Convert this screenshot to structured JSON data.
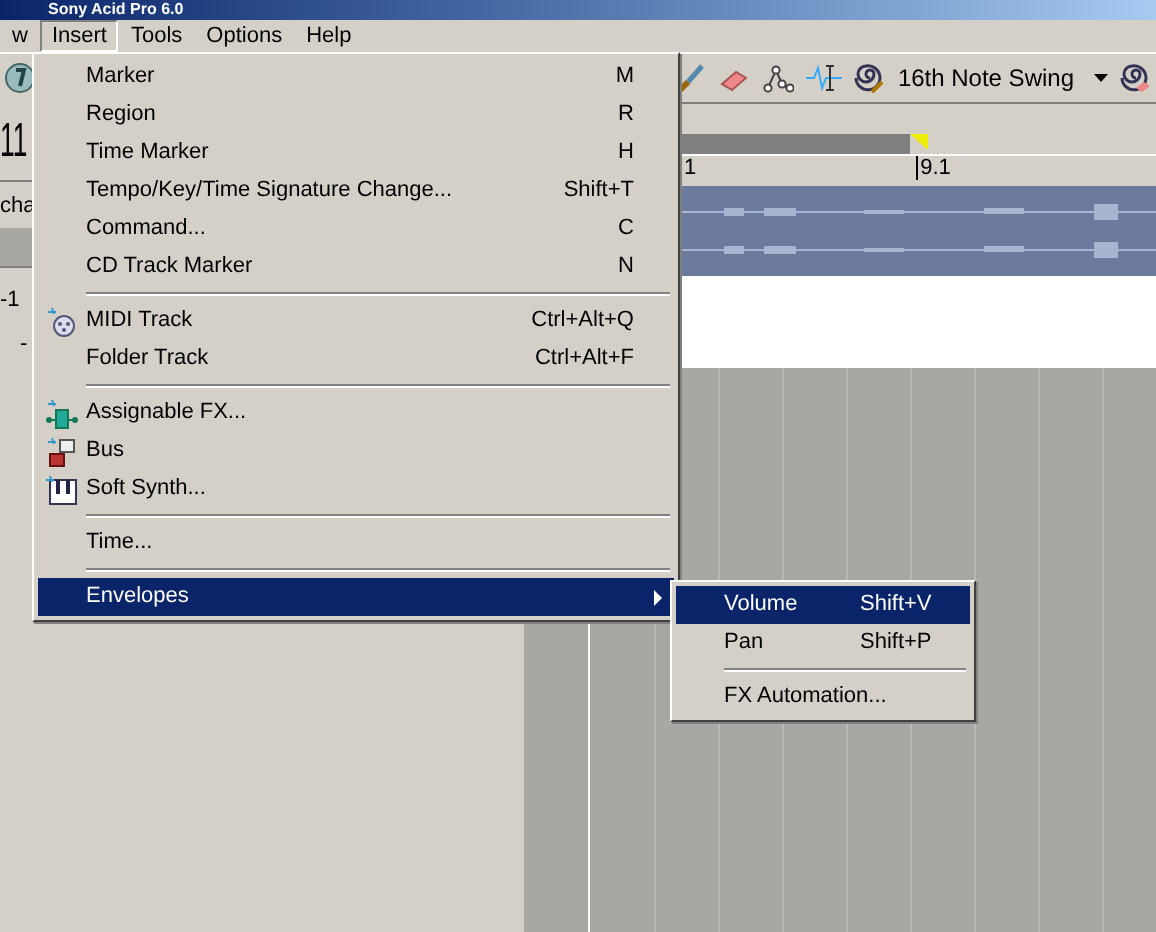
{
  "window": {
    "title": "Sony Acid Pro 6.0"
  },
  "menu_bar": [
    {
      "label": "w",
      "selected": false
    },
    {
      "label": "Insert",
      "selected": true
    },
    {
      "label": "Tools",
      "selected": false
    },
    {
      "label": "Options",
      "selected": false
    },
    {
      "label": "Help",
      "selected": false
    }
  ],
  "left_panel": {
    "counter": "11",
    "label": "cha",
    "value": "-1",
    "value_2": "-"
  },
  "toolbar": {
    "swing": "16th Note Swing"
  },
  "ruler": {
    "marks": [
      "1",
      "9.1"
    ]
  },
  "insert_menu": {
    "groups": [
      [
        {
          "kind": "plain",
          "label": "Marker",
          "shortcut": "M",
          "selected": false
        },
        {
          "kind": "plain",
          "label": "Region",
          "shortcut": "R",
          "selected": false
        },
        {
          "kind": "plain",
          "label": "Time Marker",
          "shortcut": "H",
          "selected": false
        },
        {
          "kind": "plain",
          "label": "Tempo/Key/Time Signature Change...",
          "shortcut": "Shift+T",
          "selected": false
        },
        {
          "kind": "plain",
          "label": "Command...",
          "shortcut": "C",
          "selected": false
        },
        {
          "kind": "plain",
          "label": "CD Track Marker",
          "shortcut": "N",
          "selected": false
        }
      ],
      [
        {
          "kind": "midi",
          "label": "MIDI Track",
          "shortcut": "Ctrl+Alt+Q",
          "selected": false
        },
        {
          "kind": "plain",
          "label": "Folder Track",
          "shortcut": "Ctrl+Alt+F",
          "selected": false
        }
      ],
      [
        {
          "kind": "fx",
          "label": "Assignable FX...",
          "selected": false
        },
        {
          "kind": "bus",
          "label": "Bus",
          "selected": false
        },
        {
          "kind": "synth",
          "label": "Soft Synth...",
          "selected": false
        }
      ],
      [
        {
          "kind": "plain",
          "label": "Time...",
          "selected": false
        }
      ],
      [
        {
          "kind": "submenu",
          "label": "Envelopes",
          "selected": true
        }
      ]
    ]
  },
  "envelopes_submenu": {
    "groups": [
      [
        {
          "label": "Volume",
          "shortcut": "Shift+V",
          "selected": true
        },
        {
          "label": "Pan",
          "shortcut": "Shift+P",
          "selected": false
        }
      ],
      [
        {
          "label": "FX Automation...",
          "selected": false
        }
      ]
    ]
  }
}
